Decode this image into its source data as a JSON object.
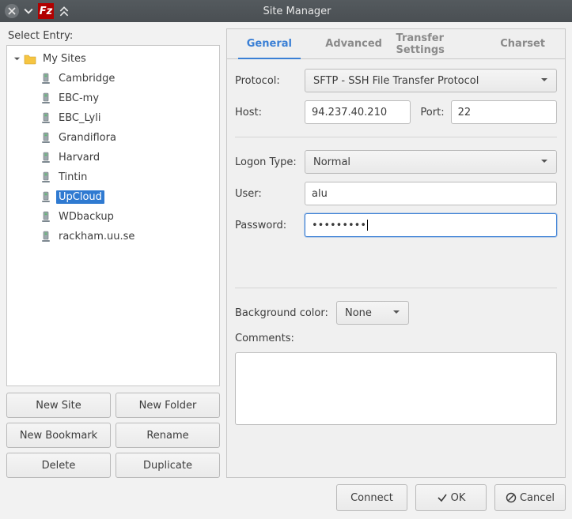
{
  "window": {
    "title": "Site Manager"
  },
  "left": {
    "select_label": "Select Entry:",
    "root_label": "My Sites",
    "sites": [
      {
        "label": "Cambridge",
        "selected": false
      },
      {
        "label": "EBC-my",
        "selected": false
      },
      {
        "label": "EBC_Lyli",
        "selected": false
      },
      {
        "label": "Grandiflora",
        "selected": false
      },
      {
        "label": "Harvard",
        "selected": false
      },
      {
        "label": "Tintin",
        "selected": false
      },
      {
        "label": "UpCloud",
        "selected": true
      },
      {
        "label": "WDbackup",
        "selected": false
      },
      {
        "label": "rackham.uu.se",
        "selected": false
      }
    ],
    "buttons": {
      "new_site": "New Site",
      "new_folder": "New Folder",
      "new_bookmark": "New Bookmark",
      "rename": "Rename",
      "delete": "Delete",
      "duplicate": "Duplicate"
    }
  },
  "tabs": {
    "general": "General",
    "advanced": "Advanced",
    "transfer": "Transfer Settings",
    "charset": "Charset"
  },
  "form": {
    "protocol_label": "Protocol:",
    "protocol_value": "SFTP - SSH File Transfer Protocol",
    "host_label": "Host:",
    "host_value": "94.237.40.210",
    "port_label": "Port:",
    "port_value": "22",
    "logon_label": "Logon Type:",
    "logon_value": "Normal",
    "user_label": "User:",
    "user_value": "alu",
    "password_label": "Password:",
    "password_value": "•••••••••",
    "bgcolor_label": "Background color:",
    "bgcolor_value": "None",
    "comments_label": "Comments:",
    "comments_value": ""
  },
  "bottom": {
    "connect": "Connect",
    "ok": "OK",
    "cancel": "Cancel"
  }
}
